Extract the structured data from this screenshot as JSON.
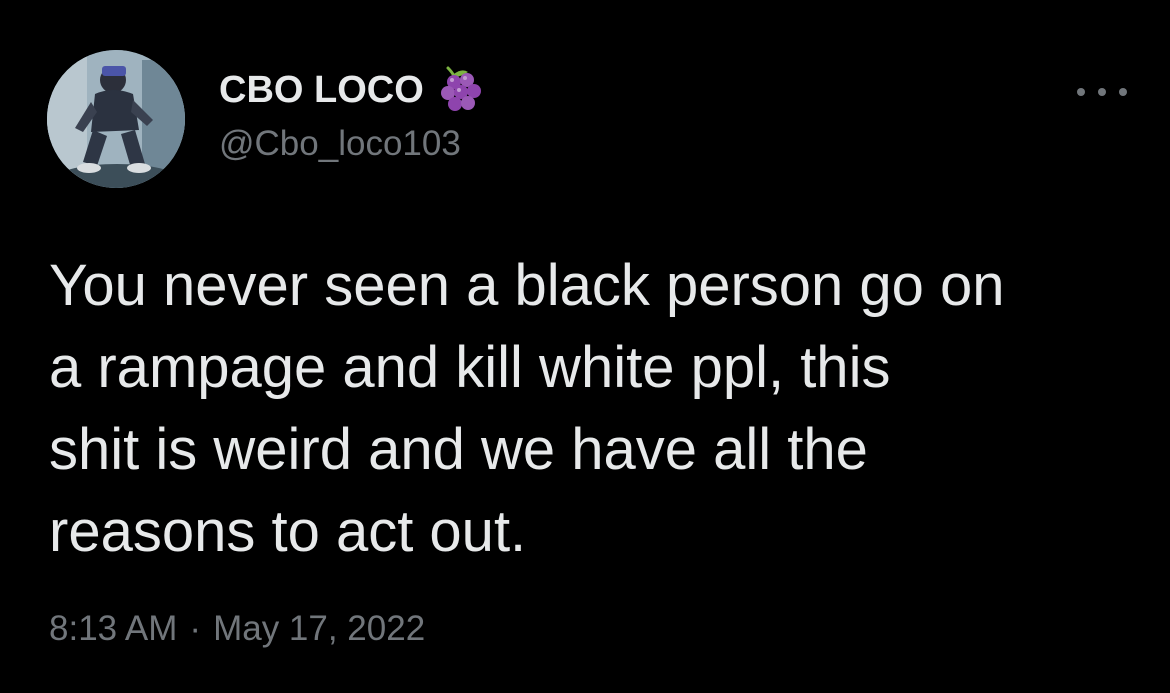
{
  "author": {
    "display_name": "CBO LOCO",
    "handle": "@Cbo_loco103",
    "badge_icon": "grapes-icon"
  },
  "tweet": {
    "text": "You never seen a black person go on\na rampage and kill white ppl, this\nshit is weird and we have all the\nreasons to act out."
  },
  "meta": {
    "time": "8:13 AM",
    "separator": "·",
    "date": "May 17, 2022"
  },
  "icons": {
    "more": "more-options-icon"
  },
  "colors": {
    "background": "#000000",
    "primary_text": "#e7e9ea",
    "secondary_text": "#71767b",
    "grapes": "#8e44ad"
  }
}
